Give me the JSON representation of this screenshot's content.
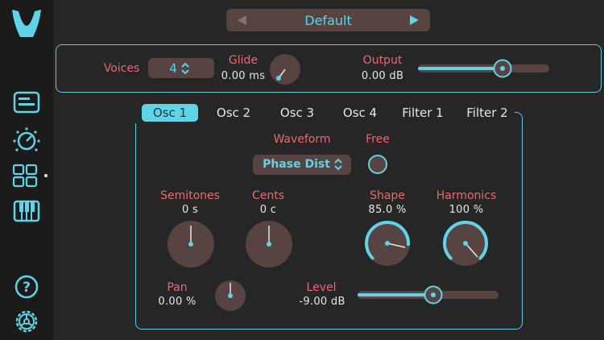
{
  "colors": {
    "accent": "#5fd4e6",
    "label": "#e86a72",
    "control_bg": "#584343",
    "background": "#262626",
    "sidebar": "#1b1b1b"
  },
  "sidebar": {
    "logo": "logo-v-icon",
    "items": [
      {
        "icon": "presets-icon"
      },
      {
        "icon": "modulation-knob-icon"
      },
      {
        "icon": "grid-icon"
      },
      {
        "icon": "keyboard-icon"
      },
      {
        "icon": "help-icon"
      },
      {
        "icon": "settings-gear-icon"
      }
    ]
  },
  "preset": {
    "name": "Default",
    "prev_icon": "triangle-left-icon",
    "next_icon": "triangle-right-icon"
  },
  "global": {
    "voices_label": "Voices",
    "voices_value": "4",
    "glide_label": "Glide",
    "glide_value": "0.00 ms",
    "glide_level": 0.0,
    "output_label": "Output",
    "output_value": "0.00 dB",
    "output_level": 0.75
  },
  "tabs": [
    {
      "label": "Osc 1",
      "active": true
    },
    {
      "label": "Osc 2",
      "active": false
    },
    {
      "label": "Osc 3",
      "active": false
    },
    {
      "label": "Osc 4",
      "active": false
    },
    {
      "label": "Filter 1",
      "active": false
    },
    {
      "label": "Filter 2",
      "active": false
    }
  ],
  "osc": {
    "waveform_label": "Waveform",
    "waveform_value": "Phase Dist",
    "free_label": "Free",
    "semitones_label": "Semitones",
    "semitones_value": "0 s",
    "cents_label": "Cents",
    "cents_value": "0 c",
    "shape_label": "Shape",
    "shape_value": "85.0 %",
    "shape_level": 0.85,
    "harmonics_label": "Harmonics",
    "harmonics_value": "100 %",
    "harmonics_level": 1.0,
    "pan_label": "Pan",
    "pan_value": "0.00 %",
    "level_label": "Level",
    "level_value": "-9.00 dB",
    "level_fill": 0.6
  }
}
